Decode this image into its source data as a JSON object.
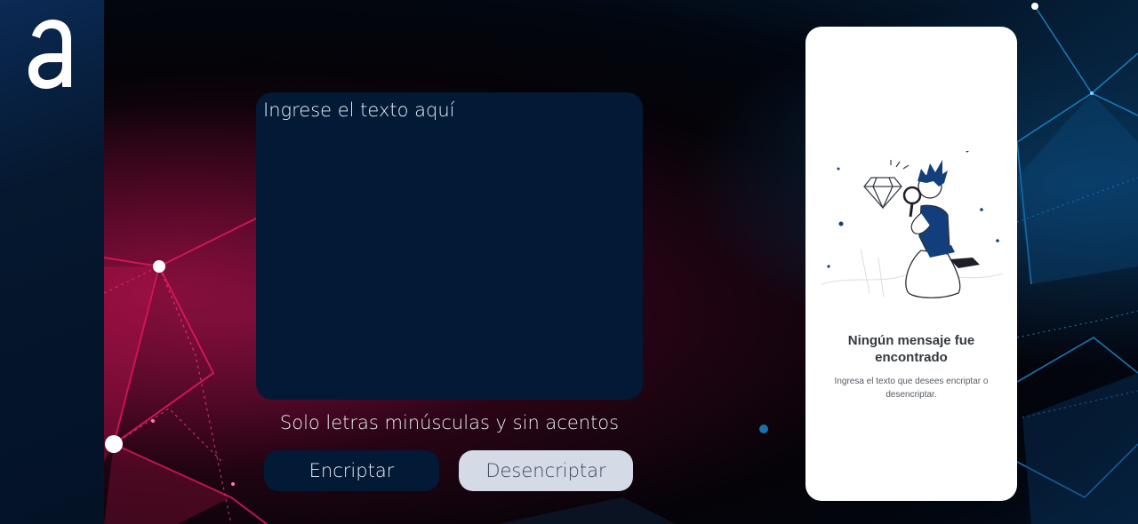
{
  "logo": {
    "letter": "a",
    "color": "#ffffff"
  },
  "input": {
    "placeholder": "Ingrese el texto aquí",
    "value": ""
  },
  "hint": "Solo letras minúsculas y sin acentos",
  "buttons": {
    "encrypt": "Encriptar",
    "decrypt": "Desencriptar"
  },
  "output_panel": {
    "title": "Ningún mensaje fue encontrado",
    "subtitle": "Ingresa el texto que desees encriptar o desencriptar.",
    "illustration": "person-with-magnifying-glass-and-diamond"
  },
  "colors": {
    "primary_dark": "#021a35",
    "secondary_button": "#d4dbe6",
    "accent_pink": "#e0185f",
    "accent_blue": "#1e8fd6"
  }
}
